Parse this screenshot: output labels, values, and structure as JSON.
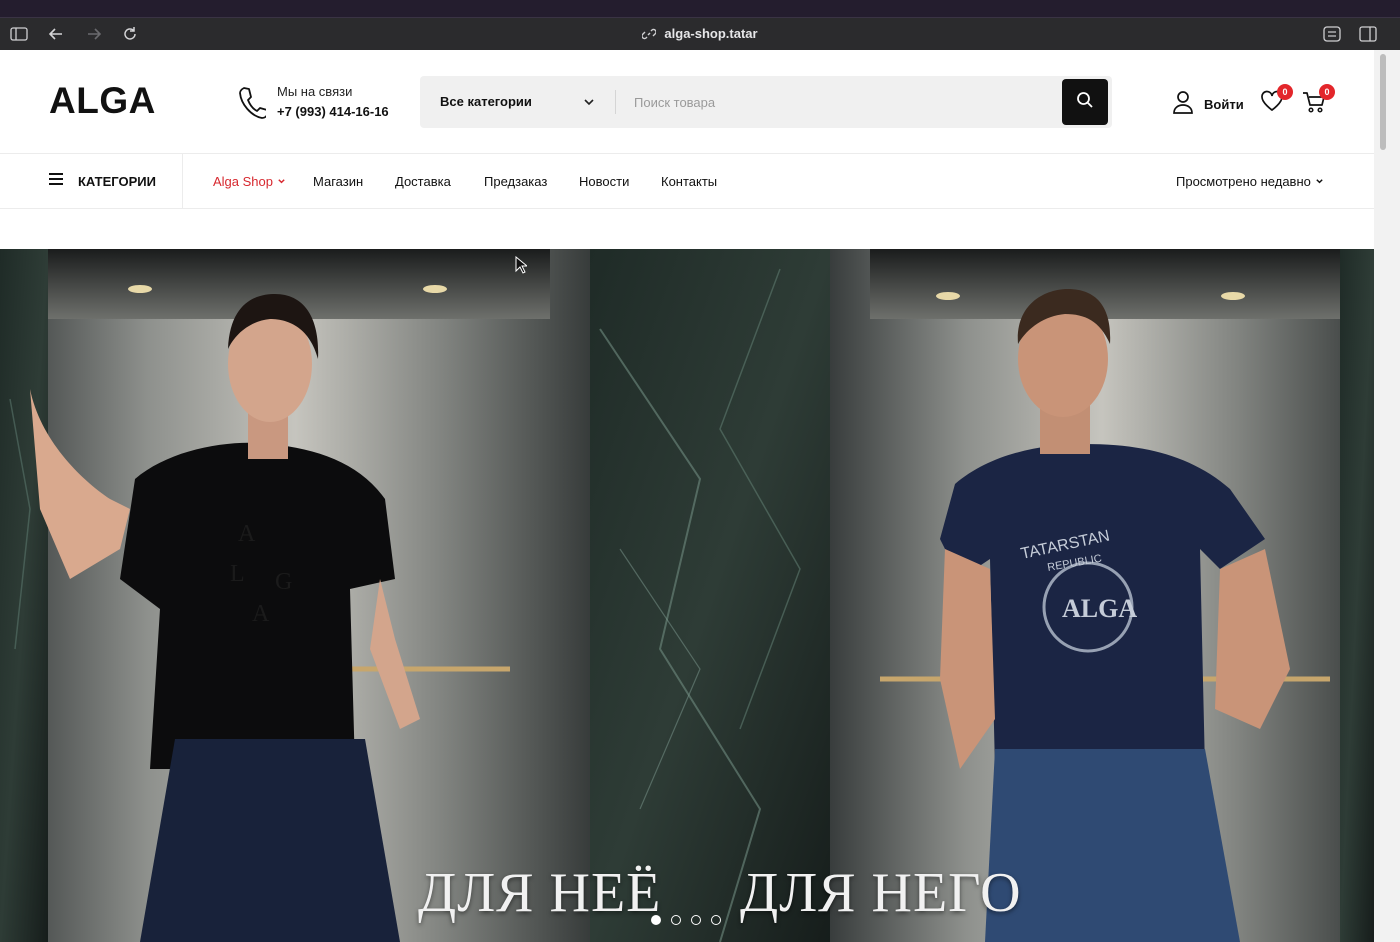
{
  "browser": {
    "url": "alga-shop.tatar"
  },
  "header": {
    "logo": "ALGA",
    "contact_label": "Мы на связи",
    "contact_phone": "+7 (993) 414-16-16",
    "search": {
      "category": "Все категории",
      "placeholder": "Поиск товара"
    },
    "login_label": "Войти",
    "wishlist_count": "0",
    "cart_count": "0"
  },
  "nav": {
    "categories_label": "КАТЕГОРИИ",
    "links": [
      {
        "label": "Alga Shop"
      },
      {
        "label": "Магазин"
      },
      {
        "label": "Доставка"
      },
      {
        "label": "Предзаказ"
      },
      {
        "label": "Новости"
      },
      {
        "label": "Контакты"
      }
    ],
    "recent_label": "Просмотрено недавно"
  },
  "hero": {
    "caption_left": "ДЛЯ НЕЁ",
    "caption_right": "ДЛЯ НЕГО",
    "slide_count": 4,
    "active_slide": 1,
    "print_woman": "ALGA",
    "print_man_top": "TATARSTAN",
    "print_man_sub": "REPUBLIC",
    "print_man_logo": "ALGA"
  },
  "colors": {
    "accent": "#d7282f",
    "badge": "#e3262b",
    "dark": "#111111"
  }
}
